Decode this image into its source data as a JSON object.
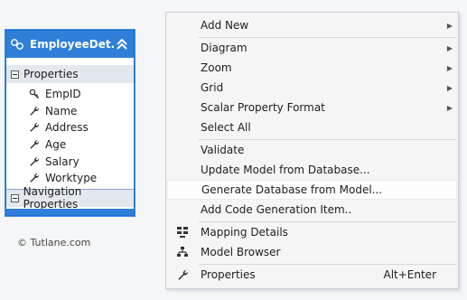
{
  "entity": {
    "title": "EmployeeDet...",
    "properties_label": "Properties",
    "properties": [
      {
        "name": "EmpID",
        "icon": "key-wrench-icon"
      },
      {
        "name": "Name",
        "icon": "wrench-icon"
      },
      {
        "name": "Address",
        "icon": "wrench-icon"
      },
      {
        "name": "Age",
        "icon": "wrench-icon"
      },
      {
        "name": "Salary",
        "icon": "wrench-icon"
      },
      {
        "name": "Worktype",
        "icon": "wrench-icon"
      }
    ],
    "nav_label": "Navigation Properties"
  },
  "copyright": "© Tutlane.com",
  "menu": {
    "items": [
      {
        "label": "Add New",
        "submenu": true
      },
      {
        "label": "Diagram",
        "submenu": true
      },
      {
        "label": "Zoom",
        "submenu": true
      },
      {
        "label": "Grid",
        "submenu": true
      },
      {
        "label": "Scalar Property Format",
        "submenu": true
      },
      {
        "label": "Select All"
      },
      {
        "label": "Validate"
      },
      {
        "label": "Update Model from Database..."
      },
      {
        "label": "Generate Database from Model..."
      },
      {
        "label": "Add Code Generation Item.."
      },
      {
        "label": "Mapping Details",
        "icon": "mapping-details-icon"
      },
      {
        "label": "Model Browser",
        "icon": "model-browser-icon"
      },
      {
        "label": "Properties",
        "icon": "wrench-icon",
        "shortcut": "Alt+Enter"
      }
    ]
  },
  "colors": {
    "entity_header": "#2f7fd9",
    "menu_bg": "#f5f5f5",
    "highlight": "#fdfdfd"
  }
}
